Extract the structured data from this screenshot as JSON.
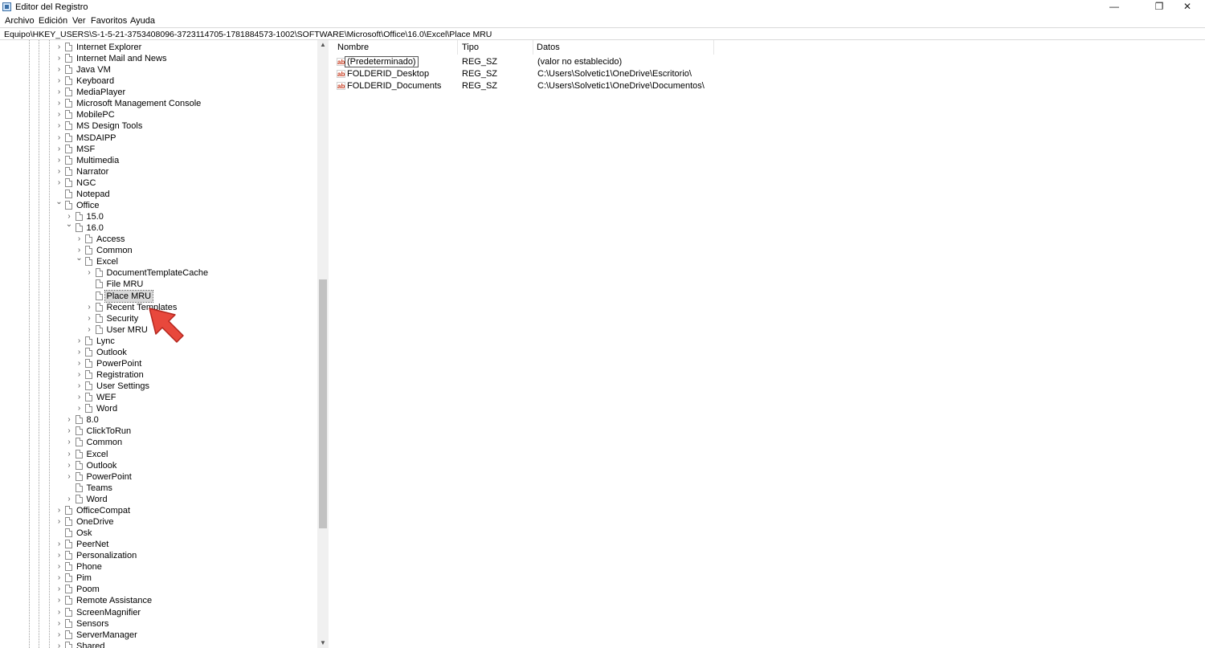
{
  "window": {
    "title": "Editor del Registro",
    "minimize": "—",
    "restore": "❐",
    "close": "✕"
  },
  "menu": [
    "Archivo",
    "Edición",
    "Ver",
    "Favoritos",
    "Ayuda"
  ],
  "address": "Equipo\\HKEY_USERS\\S-1-5-21-3753408096-3723114705-1781884573-1002\\SOFTWARE\\Microsoft\\Office\\16.0\\Excel\\Place MRU",
  "tree": [
    {
      "label": "Internet Explorer",
      "depth": 0,
      "expander": "collapsed"
    },
    {
      "label": "Internet Mail and News",
      "depth": 0,
      "expander": "collapsed"
    },
    {
      "label": "Java VM",
      "depth": 0,
      "expander": "collapsed"
    },
    {
      "label": "Keyboard",
      "depth": 0,
      "expander": "collapsed"
    },
    {
      "label": "MediaPlayer",
      "depth": 0,
      "expander": "collapsed"
    },
    {
      "label": "Microsoft Management Console",
      "depth": 0,
      "expander": "collapsed"
    },
    {
      "label": "MobilePC",
      "depth": 0,
      "expander": "collapsed"
    },
    {
      "label": "MS Design Tools",
      "depth": 0,
      "expander": "collapsed"
    },
    {
      "label": "MSDAIPP",
      "depth": 0,
      "expander": "collapsed"
    },
    {
      "label": "MSF",
      "depth": 0,
      "expander": "collapsed"
    },
    {
      "label": "Multimedia",
      "depth": 0,
      "expander": "collapsed"
    },
    {
      "label": "Narrator",
      "depth": 0,
      "expander": "collapsed"
    },
    {
      "label": "NGC",
      "depth": 0,
      "expander": "collapsed"
    },
    {
      "label": "Notepad",
      "depth": 0,
      "expander": "none"
    },
    {
      "label": "Office",
      "depth": 0,
      "expander": "expanded"
    },
    {
      "label": "15.0",
      "depth": 1,
      "expander": "collapsed"
    },
    {
      "label": "16.0",
      "depth": 1,
      "expander": "expanded"
    },
    {
      "label": "Access",
      "depth": 2,
      "expander": "collapsed"
    },
    {
      "label": "Common",
      "depth": 2,
      "expander": "collapsed"
    },
    {
      "label": "Excel",
      "depth": 2,
      "expander": "expanded"
    },
    {
      "label": "DocumentTemplateCache",
      "depth": 3,
      "expander": "collapsed"
    },
    {
      "label": "File MRU",
      "depth": 3,
      "expander": "none"
    },
    {
      "label": "Place MRU",
      "depth": 3,
      "expander": "none",
      "selected": true
    },
    {
      "label": "Recent Templates",
      "depth": 3,
      "expander": "collapsed"
    },
    {
      "label": "Security",
      "depth": 3,
      "expander": "collapsed"
    },
    {
      "label": "User MRU",
      "depth": 3,
      "expander": "collapsed"
    },
    {
      "label": "Lync",
      "depth": 2,
      "expander": "collapsed"
    },
    {
      "label": "Outlook",
      "depth": 2,
      "expander": "collapsed"
    },
    {
      "label": "PowerPoint",
      "depth": 2,
      "expander": "collapsed"
    },
    {
      "label": "Registration",
      "depth": 2,
      "expander": "collapsed"
    },
    {
      "label": "User Settings",
      "depth": 2,
      "expander": "collapsed"
    },
    {
      "label": "WEF",
      "depth": 2,
      "expander": "collapsed"
    },
    {
      "label": "Word",
      "depth": 2,
      "expander": "collapsed"
    },
    {
      "label": "8.0",
      "depth": 1,
      "expander": "collapsed"
    },
    {
      "label": "ClickToRun",
      "depth": 1,
      "expander": "collapsed"
    },
    {
      "label": "Common",
      "depth": 1,
      "expander": "collapsed"
    },
    {
      "label": "Excel",
      "depth": 1,
      "expander": "collapsed"
    },
    {
      "label": "Outlook",
      "depth": 1,
      "expander": "collapsed"
    },
    {
      "label": "PowerPoint",
      "depth": 1,
      "expander": "collapsed"
    },
    {
      "label": "Teams",
      "depth": 1,
      "expander": "none"
    },
    {
      "label": "Word",
      "depth": 1,
      "expander": "collapsed"
    },
    {
      "label": "OfficeCompat",
      "depth": 0,
      "expander": "collapsed"
    },
    {
      "label": "OneDrive",
      "depth": 0,
      "expander": "collapsed"
    },
    {
      "label": "Osk",
      "depth": 0,
      "expander": "none"
    },
    {
      "label": "PeerNet",
      "depth": 0,
      "expander": "collapsed"
    },
    {
      "label": "Personalization",
      "depth": 0,
      "expander": "collapsed"
    },
    {
      "label": "Phone",
      "depth": 0,
      "expander": "collapsed"
    },
    {
      "label": "Pim",
      "depth": 0,
      "expander": "collapsed"
    },
    {
      "label": "Poom",
      "depth": 0,
      "expander": "collapsed"
    },
    {
      "label": "Remote Assistance",
      "depth": 0,
      "expander": "collapsed"
    },
    {
      "label": "ScreenMagnifier",
      "depth": 0,
      "expander": "collapsed"
    },
    {
      "label": "Sensors",
      "depth": 0,
      "expander": "collapsed"
    },
    {
      "label": "ServerManager",
      "depth": 0,
      "expander": "collapsed"
    },
    {
      "label": "Shared",
      "depth": 0,
      "expander": "collapsed"
    }
  ],
  "columns": [
    "Nombre",
    "Tipo",
    "Datos"
  ],
  "values": [
    {
      "name": "(Predeterminado)",
      "type": "REG_SZ",
      "data": "(valor no establecido)",
      "icon": "ab-string-icon",
      "selected": true
    },
    {
      "name": "FOLDERID_Desktop",
      "type": "REG_SZ",
      "data": "C:\\Users\\Solvetic1\\OneDrive\\Escritorio\\",
      "icon": "ab-string-icon"
    },
    {
      "name": "FOLDERID_Documents",
      "type": "REG_SZ",
      "data": "C:\\Users\\Solvetic1\\OneDrive\\Documentos\\",
      "icon": "ab-string-icon"
    }
  ],
  "colors": {
    "selection": "#d9d9d9",
    "string_icon": "#c83a1e",
    "pointer": "#e8483c"
  }
}
